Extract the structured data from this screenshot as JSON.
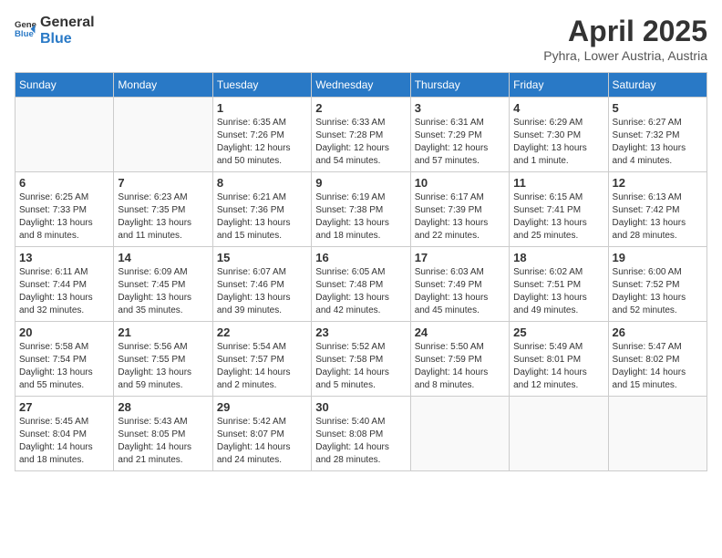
{
  "header": {
    "logo_general": "General",
    "logo_blue": "Blue",
    "month_title": "April 2025",
    "subtitle": "Pyhra, Lower Austria, Austria"
  },
  "days_of_week": [
    "Sunday",
    "Monday",
    "Tuesday",
    "Wednesday",
    "Thursday",
    "Friday",
    "Saturday"
  ],
  "weeks": [
    [
      {
        "day": "",
        "info": ""
      },
      {
        "day": "",
        "info": ""
      },
      {
        "day": "1",
        "info": "Sunrise: 6:35 AM\nSunset: 7:26 PM\nDaylight: 12 hours and 50 minutes."
      },
      {
        "day": "2",
        "info": "Sunrise: 6:33 AM\nSunset: 7:28 PM\nDaylight: 12 hours and 54 minutes."
      },
      {
        "day": "3",
        "info": "Sunrise: 6:31 AM\nSunset: 7:29 PM\nDaylight: 12 hours and 57 minutes."
      },
      {
        "day": "4",
        "info": "Sunrise: 6:29 AM\nSunset: 7:30 PM\nDaylight: 13 hours and 1 minute."
      },
      {
        "day": "5",
        "info": "Sunrise: 6:27 AM\nSunset: 7:32 PM\nDaylight: 13 hours and 4 minutes."
      }
    ],
    [
      {
        "day": "6",
        "info": "Sunrise: 6:25 AM\nSunset: 7:33 PM\nDaylight: 13 hours and 8 minutes."
      },
      {
        "day": "7",
        "info": "Sunrise: 6:23 AM\nSunset: 7:35 PM\nDaylight: 13 hours and 11 minutes."
      },
      {
        "day": "8",
        "info": "Sunrise: 6:21 AM\nSunset: 7:36 PM\nDaylight: 13 hours and 15 minutes."
      },
      {
        "day": "9",
        "info": "Sunrise: 6:19 AM\nSunset: 7:38 PM\nDaylight: 13 hours and 18 minutes."
      },
      {
        "day": "10",
        "info": "Sunrise: 6:17 AM\nSunset: 7:39 PM\nDaylight: 13 hours and 22 minutes."
      },
      {
        "day": "11",
        "info": "Sunrise: 6:15 AM\nSunset: 7:41 PM\nDaylight: 13 hours and 25 minutes."
      },
      {
        "day": "12",
        "info": "Sunrise: 6:13 AM\nSunset: 7:42 PM\nDaylight: 13 hours and 28 minutes."
      }
    ],
    [
      {
        "day": "13",
        "info": "Sunrise: 6:11 AM\nSunset: 7:44 PM\nDaylight: 13 hours and 32 minutes."
      },
      {
        "day": "14",
        "info": "Sunrise: 6:09 AM\nSunset: 7:45 PM\nDaylight: 13 hours and 35 minutes."
      },
      {
        "day": "15",
        "info": "Sunrise: 6:07 AM\nSunset: 7:46 PM\nDaylight: 13 hours and 39 minutes."
      },
      {
        "day": "16",
        "info": "Sunrise: 6:05 AM\nSunset: 7:48 PM\nDaylight: 13 hours and 42 minutes."
      },
      {
        "day": "17",
        "info": "Sunrise: 6:03 AM\nSunset: 7:49 PM\nDaylight: 13 hours and 45 minutes."
      },
      {
        "day": "18",
        "info": "Sunrise: 6:02 AM\nSunset: 7:51 PM\nDaylight: 13 hours and 49 minutes."
      },
      {
        "day": "19",
        "info": "Sunrise: 6:00 AM\nSunset: 7:52 PM\nDaylight: 13 hours and 52 minutes."
      }
    ],
    [
      {
        "day": "20",
        "info": "Sunrise: 5:58 AM\nSunset: 7:54 PM\nDaylight: 13 hours and 55 minutes."
      },
      {
        "day": "21",
        "info": "Sunrise: 5:56 AM\nSunset: 7:55 PM\nDaylight: 13 hours and 59 minutes."
      },
      {
        "day": "22",
        "info": "Sunrise: 5:54 AM\nSunset: 7:57 PM\nDaylight: 14 hours and 2 minutes."
      },
      {
        "day": "23",
        "info": "Sunrise: 5:52 AM\nSunset: 7:58 PM\nDaylight: 14 hours and 5 minutes."
      },
      {
        "day": "24",
        "info": "Sunrise: 5:50 AM\nSunset: 7:59 PM\nDaylight: 14 hours and 8 minutes."
      },
      {
        "day": "25",
        "info": "Sunrise: 5:49 AM\nSunset: 8:01 PM\nDaylight: 14 hours and 12 minutes."
      },
      {
        "day": "26",
        "info": "Sunrise: 5:47 AM\nSunset: 8:02 PM\nDaylight: 14 hours and 15 minutes."
      }
    ],
    [
      {
        "day": "27",
        "info": "Sunrise: 5:45 AM\nSunset: 8:04 PM\nDaylight: 14 hours and 18 minutes."
      },
      {
        "day": "28",
        "info": "Sunrise: 5:43 AM\nSunset: 8:05 PM\nDaylight: 14 hours and 21 minutes."
      },
      {
        "day": "29",
        "info": "Sunrise: 5:42 AM\nSunset: 8:07 PM\nDaylight: 14 hours and 24 minutes."
      },
      {
        "day": "30",
        "info": "Sunrise: 5:40 AM\nSunset: 8:08 PM\nDaylight: 14 hours and 28 minutes."
      },
      {
        "day": "",
        "info": ""
      },
      {
        "day": "",
        "info": ""
      },
      {
        "day": "",
        "info": ""
      }
    ]
  ]
}
